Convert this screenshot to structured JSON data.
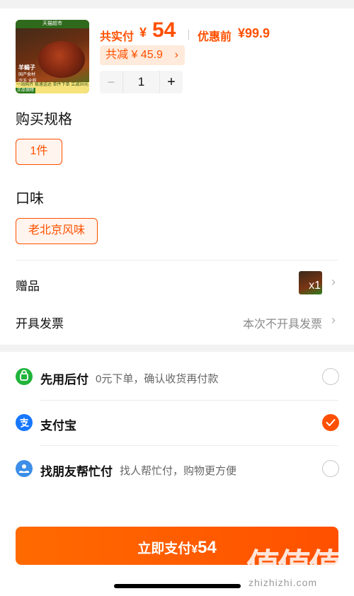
{
  "product": {
    "thumb_store": "天猫超市",
    "thumb_brand": "羊蝎子",
    "thumb_tags": "国产食材 冷冻 全程冷链",
    "thumb_bottom": "一站购齐 极速送达\n单件下单 立减30元",
    "thumb_guarantee": "正品保障",
    "total_label": "共实付",
    "currency": "¥",
    "total_amount": "54",
    "original_label": "优惠前",
    "original_amount": "¥99.9",
    "saving_text": "共减 ¥ 45.9",
    "quantity": "1"
  },
  "spec": {
    "title": "购买规格",
    "selected": "1件"
  },
  "flavor": {
    "title": "口味",
    "selected": "老北京风味"
  },
  "gift": {
    "label": "赠品",
    "quantity": "x1"
  },
  "invoice": {
    "label": "开具发票",
    "value": "本次不开具发票"
  },
  "payment_methods": [
    {
      "name": "先用后付",
      "description": "0元下单，确认收货再付款",
      "icon": "pay-later-icon",
      "color": "#21b43c",
      "selected": false
    },
    {
      "name": "支付宝",
      "description": "",
      "icon": "alipay-icon",
      "color": "#1677ff",
      "selected": true
    },
    {
      "name": "找朋友帮忙付",
      "description": "找人帮忙付，购物更方便",
      "icon": "friend-pay-icon",
      "color": "#3d8ee8",
      "selected": false
    }
  ],
  "pay_button": {
    "label": "立即支付",
    "currency": "¥",
    "amount": "54"
  },
  "watermark": {
    "logo": "值值值",
    "site": "zhizhizhi.com"
  },
  "colors": {
    "accent": "#ff5000",
    "accent_light": "#fff4ee",
    "muted_text": "#8a8a8a"
  }
}
